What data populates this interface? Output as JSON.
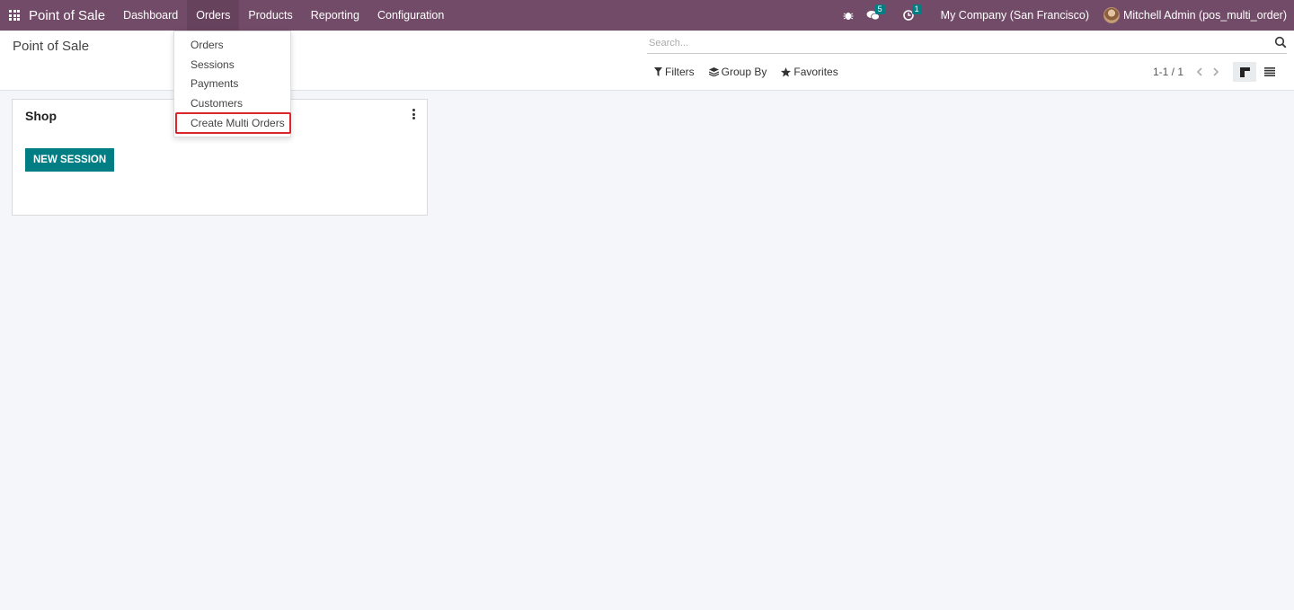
{
  "navbar": {
    "brand": "Point of Sale",
    "menu": [
      {
        "label": "Dashboard",
        "active": false
      },
      {
        "label": "Orders",
        "active": true
      },
      {
        "label": "Products",
        "active": false
      },
      {
        "label": "Reporting",
        "active": false
      },
      {
        "label": "Configuration",
        "active": false
      }
    ],
    "messages_badge": "5",
    "activities_badge": "1",
    "company": "My Company (San Francisco)",
    "user": "Mitchell Admin (pos_multi_order)",
    "icons": [
      "apps-icon",
      "bug-icon",
      "chat-icon",
      "clock-icon"
    ]
  },
  "orders_dropdown": {
    "items": [
      "Orders",
      "Sessions",
      "Payments",
      "Customers",
      "Create Multi Orders"
    ],
    "highlighted": "Create Multi Orders",
    "highlight_color": "#d9272e"
  },
  "control_panel": {
    "title": "Point of Sale",
    "search_placeholder": "Search...",
    "filters_label": "Filters",
    "group_by_label": "Group By",
    "favorites_label": "Favorites",
    "pager": "1-1 / 1"
  },
  "card": {
    "title": "Shop",
    "button_label": "NEW SESSION"
  },
  "colors": {
    "navbar": "#714b67",
    "primary_button": "#017e84",
    "badge": "#017e84",
    "background": "#f5f6fa"
  }
}
